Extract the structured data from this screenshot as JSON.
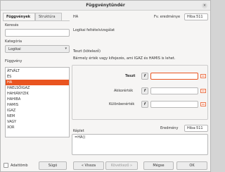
{
  "window": {
    "title": "Függvénytündér",
    "close_glyph": "×"
  },
  "tabs": [
    {
      "label": "Függvények",
      "active": true
    },
    {
      "label": "Struktúra",
      "active": false
    }
  ],
  "search": {
    "label": "Keresés",
    "value": ""
  },
  "category": {
    "label": "Kategória",
    "value": "Logikai"
  },
  "functions": {
    "label": "Függvény",
    "items": [
      "ÁTVÁLT",
      "ÉS",
      "HA",
      "HAELSŐIGAZ",
      "HAHIÁNYZIK",
      "HAHIBA",
      "HAMIS",
      "IGAZ",
      "NEM",
      "VAGY",
      "XOR"
    ],
    "selected": "HA"
  },
  "function_info": {
    "name": "HA",
    "result_label": "Fv. eredménye",
    "result_value": "Hiba:511",
    "description": "Logikai feltételvizsgálat",
    "param_title": "Teszt (kötelező)",
    "param_description": "Bármely érték vagy kifejezés, ami IGAZ és HAMIS is lehet."
  },
  "arguments": [
    {
      "label": "Teszt",
      "bold": true,
      "value": "",
      "fx": "f"
    },
    {
      "label": "Akkorérték",
      "bold": false,
      "value": "",
      "fx": "f"
    },
    {
      "label": "Különbenérték",
      "bold": false,
      "value": "",
      "fx": "f"
    }
  ],
  "formula": {
    "label": "Képlet",
    "result_label": "Eredmény",
    "result_value": "Hiba:511",
    "value": "=HA()"
  },
  "footer": {
    "array_label": "Adattömb",
    "help": "Súgó",
    "back": "« Vissza",
    "next": "Következő »",
    "cancel": "Mégse",
    "ok": "OK"
  },
  "colors": {
    "accent": "#e95420",
    "selection_text": "#ffffff",
    "window_bg": "#f6f5f4"
  }
}
